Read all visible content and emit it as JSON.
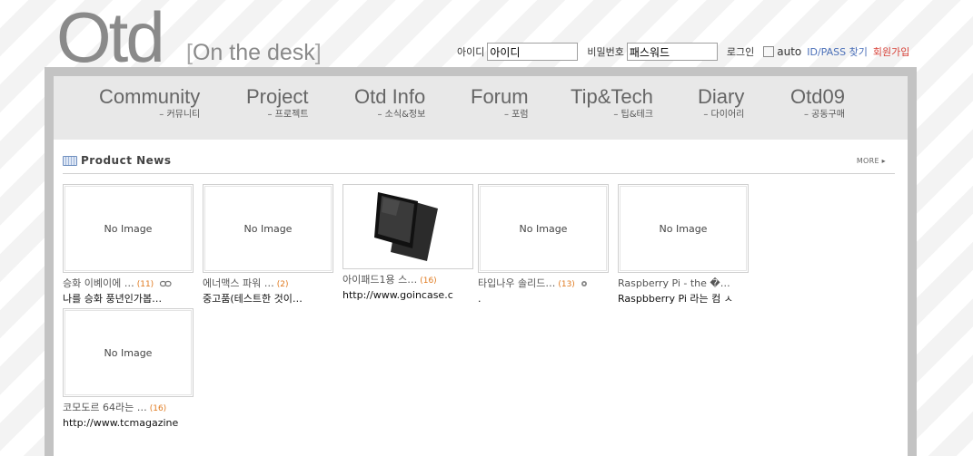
{
  "logo": {
    "main": "Otd",
    "sub_open": "[",
    "sub_text": "On the desk",
    "sub_close": "]"
  },
  "login": {
    "id_label": "아이디",
    "id_value": "아이디",
    "pw_label": "비밀번호",
    "pw_value": "패스워드",
    "login_label": "로그인",
    "auto_label": "auto",
    "find_label": "ID/PASS 찾기",
    "join_label": "회원가입"
  },
  "nav": [
    {
      "en": "Community",
      "ko": "– 커뮤니티"
    },
    {
      "en": "Project",
      "ko": "– 프로젝트"
    },
    {
      "en": "Otd Info",
      "ko": "– 소식&정보"
    },
    {
      "en": "Forum",
      "ko": "– 포럼"
    },
    {
      "en": "Tip&Tech",
      "ko": "– 팁&테크"
    },
    {
      "en": "Diary",
      "ko": "– 다이어리"
    },
    {
      "en": "Otd09",
      "ko": "– 공동구매"
    }
  ],
  "section": {
    "title": "Product News",
    "more_label": "MORE ▸"
  },
  "cards": [
    {
      "image": "No Image",
      "title": "승화 이볘이에 …",
      "count": "(11)",
      "desc": "나를 승화 풍년인가봅…"
    },
    {
      "image": "No Image",
      "title": "에너맥스 파워 …",
      "count": "(2)",
      "desc": "중고품(테스트한 것이…"
    },
    {
      "image": "",
      "title": "아이패드1용 스…",
      "count": "(16)",
      "desc": "http://www.goincase.c"
    },
    {
      "image": "No Image",
      "title": "타입나우 솔리드…",
      "count": "(13)",
      "desc": "."
    },
    {
      "image": "No Image",
      "title": "Raspberry Pi - the �…",
      "count": "",
      "desc": "Raspbberry Pi 라는 컴 ㅅ"
    },
    {
      "image": "No Image",
      "title": "코모도르 64라는 …",
      "count": "(16)",
      "desc": "http://www.tcmagazine"
    }
  ]
}
